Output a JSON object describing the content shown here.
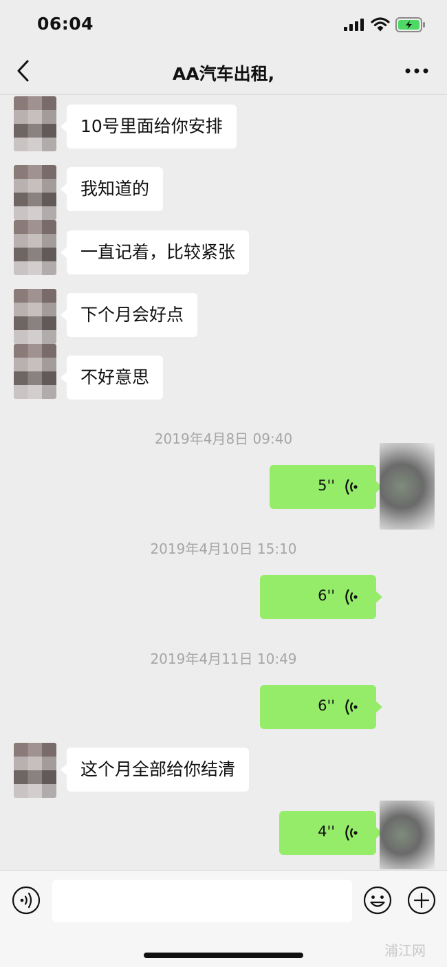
{
  "status_bar": {
    "time": "06:04"
  },
  "nav": {
    "title": "AA汽车出租,"
  },
  "messages_before": [
    {
      "text": "10号里面给你安排"
    },
    {
      "text": "我知道的"
    },
    {
      "text": "一直记着，比较紧张"
    },
    {
      "text": "下个月会好点"
    },
    {
      "text": "不好意思"
    }
  ],
  "voice_messages": [
    {
      "timestamp": "2019年4月8日 09:40",
      "duration": "5''"
    },
    {
      "timestamp": "2019年4月10日 15:10",
      "duration": "6''"
    },
    {
      "timestamp": "2019年4月11日 10:49",
      "duration": "6''"
    }
  ],
  "message_after": {
    "text": "这个月全部给你结清"
  },
  "last_voice": {
    "duration": "4''"
  },
  "watermark": "浦江网",
  "colors": {
    "background": "#ededed",
    "outgoing_bubble": "#95ec69",
    "incoming_bubble": "#ffffff",
    "timestamp_text": "#a6a6a6"
  },
  "icons": [
    "back-icon",
    "more-icon",
    "signal-icon",
    "wifi-icon",
    "battery-icon",
    "voice-wave-icon",
    "voice-toggle-icon",
    "emoji-icon",
    "plus-icon"
  ]
}
